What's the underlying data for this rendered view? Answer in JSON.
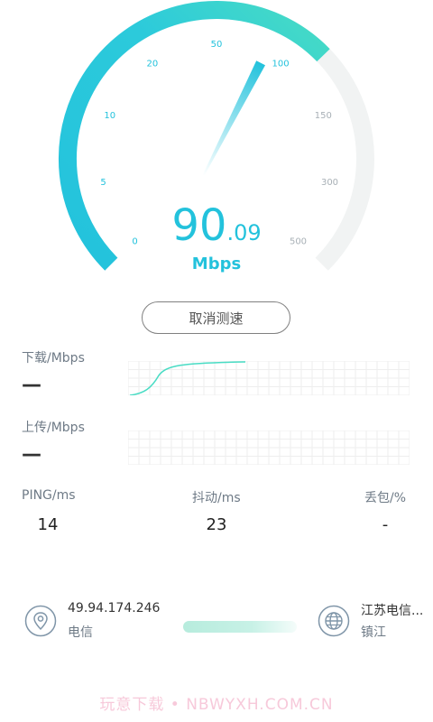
{
  "gauge": {
    "ticks": [
      "0",
      "5",
      "10",
      "20",
      "50",
      "100",
      "150",
      "300",
      "500"
    ],
    "progress_fraction": 0.67,
    "needle_value": 90.09,
    "speed_int": "90",
    "speed_dec": ".09",
    "unit": "Mbps"
  },
  "cancel_label": "取消测速",
  "download": {
    "label": "下载/Mbps",
    "value": "—"
  },
  "upload": {
    "label": "上传/Mbps",
    "value": "—"
  },
  "stats": {
    "ping_label": "PING/ms",
    "ping_value": "14",
    "jitter_label": "抖动/ms",
    "jitter_value": "23",
    "loss_label": "丢包/%",
    "loss_value": "-"
  },
  "client": {
    "ip": "49.94.174.246",
    "isp": "电信"
  },
  "server": {
    "name": "江苏电信...",
    "city": "镇江"
  },
  "watermark": "玩意下载 • NBWYXH.COM.CN",
  "colors": {
    "accent": "#23c2dc",
    "accent_green": "#48dcc4",
    "track": "#f1f3f3",
    "grid": "#eeeeee"
  }
}
